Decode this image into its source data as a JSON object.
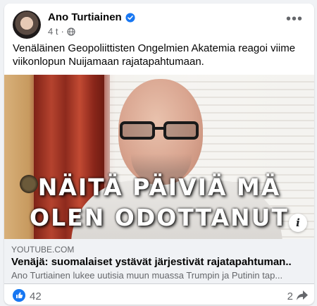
{
  "post": {
    "author": "Ano Turtiainen",
    "time": "4 t",
    "text": "Venäläinen Geopoliittisten Ongelmien Akatemia reagoi viime viikonlopun Nuijamaan rajatapahtumaan.",
    "icons": {
      "verified": "verified-badge-icon",
      "audience": "globe-icon",
      "menu": "more-options-icon"
    }
  },
  "video": {
    "overlay_line1": "NÄITÄ PÄIVIÄ MÄ",
    "overlay_line2": "OLEN ODOTTANUT",
    "info_label": "i"
  },
  "link": {
    "domain": "YOUTUBE.COM",
    "title": "Venäjä: suomalaiset ystävät järjestivät rajatapahtuman..",
    "description": "Ano Turtiainen lukee uutisia muun muassa Trumpin ja Putinin tap..."
  },
  "footer": {
    "likes": "42",
    "shares": "2"
  },
  "colors": {
    "facebook_blue": "#1877f2",
    "secondary_text": "#65676b"
  }
}
